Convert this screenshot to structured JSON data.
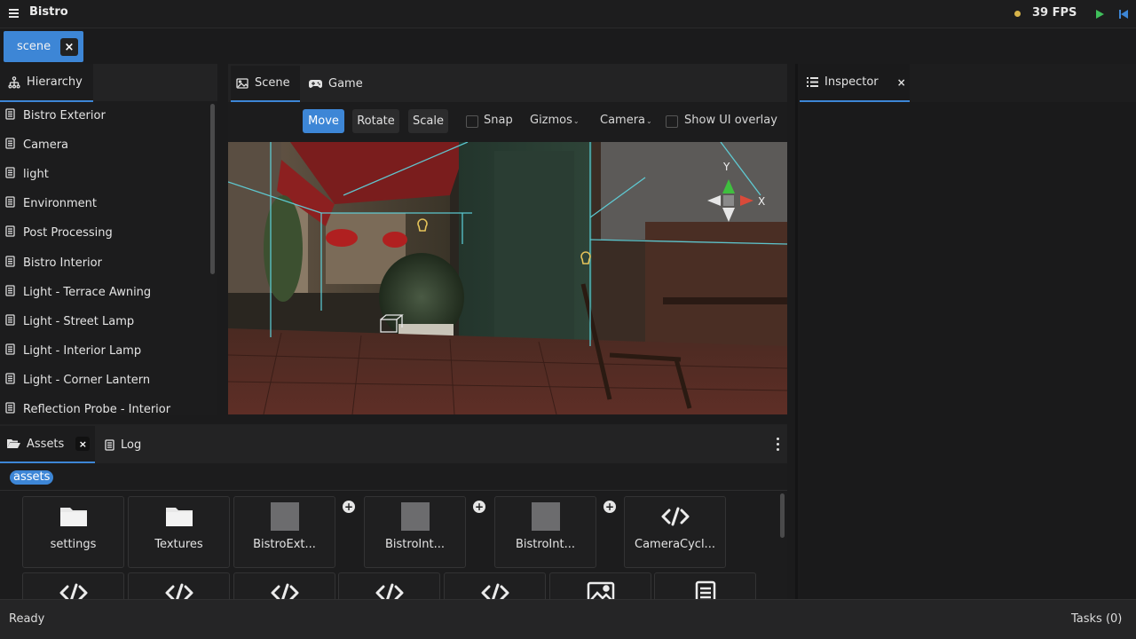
{
  "app": {
    "title": "Bistro",
    "fps": "39 FPS"
  },
  "document_tab": {
    "label": "scene",
    "close": "×"
  },
  "hierarchy": {
    "tab_label": "Hierarchy",
    "items": [
      {
        "label": "Bistro Exterior"
      },
      {
        "label": "Camera"
      },
      {
        "label": "light"
      },
      {
        "label": "Environment"
      },
      {
        "label": "Post Processing"
      },
      {
        "label": "Bistro Interior"
      },
      {
        "label": "Light - Terrace Awning"
      },
      {
        "label": "Light - Street Lamp"
      },
      {
        "label": "Light - Interior Lamp"
      },
      {
        "label": "Light - Corner Lantern"
      },
      {
        "label": "Reflection Probe - Interior"
      }
    ]
  },
  "viewport": {
    "tabs": {
      "scene": "Scene",
      "game": "Game"
    },
    "toolbar": {
      "move": "Move",
      "rotate": "Rotate",
      "scale": "Scale",
      "snap": "Snap",
      "gizmos": "Gizmos",
      "camera": "Camera",
      "show_ui_overlay": "Show UI overlay"
    },
    "gizmo": {
      "x_label": "X",
      "y_label": "Y"
    }
  },
  "inspector": {
    "tab_label": "Inspector",
    "close": "×"
  },
  "assets": {
    "tab_label": "Assets",
    "close": "×",
    "log_label": "Log",
    "breadcrumb": "assets",
    "row1": [
      {
        "label": "settings",
        "icon": "folder-icon"
      },
      {
        "label": "Textures",
        "icon": "folder-icon"
      },
      {
        "label": "BistroExt...",
        "icon": "thumbnail"
      },
      {
        "label": "BistroInt...",
        "icon": "thumbnail"
      },
      {
        "label": "BistroInt...",
        "icon": "thumbnail"
      },
      {
        "label": "CameraCycl...",
        "icon": "code-icon"
      }
    ],
    "row2_icons": [
      "code-icon",
      "code-icon",
      "code-icon",
      "code-icon",
      "code-icon",
      "image-icon",
      "document-icon"
    ]
  },
  "status": {
    "text": "Ready",
    "tasks": "Tasks (0)"
  },
  "colors": {
    "accent": "#3d86d6",
    "fps_dot": "#d6b34a",
    "play": "#3fbf5b"
  }
}
